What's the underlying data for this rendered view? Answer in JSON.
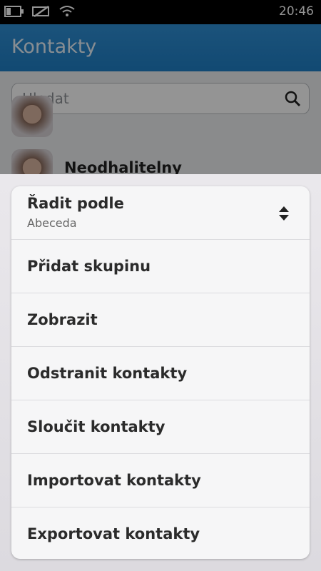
{
  "status_bar": {
    "time": "20:46",
    "icons": [
      "battery-icon",
      "signal-off-icon",
      "wifi-icon"
    ]
  },
  "app": {
    "title": "Kontakty",
    "search": {
      "placeholder": "Hledat",
      "icon": "search-icon"
    },
    "contacts": [
      {
        "name": ""
      },
      {
        "name": "Neodhalitelny"
      }
    ]
  },
  "menu": {
    "sort": {
      "title": "Řadit podle",
      "value": "Abeceda",
      "icon": "updown-arrows-icon"
    },
    "items": [
      {
        "label": "Přidat skupinu"
      },
      {
        "label": "Zobrazit"
      },
      {
        "label": "Odstranit kontakty"
      },
      {
        "label": "Sloučit kontakty"
      },
      {
        "label": "Importovat kontakty"
      },
      {
        "label": "Exportovat kontakty"
      }
    ]
  },
  "colors": {
    "header": "#1f7fc6",
    "menu_bg": "#f6f6f7",
    "text": "#2b2b2b"
  }
}
